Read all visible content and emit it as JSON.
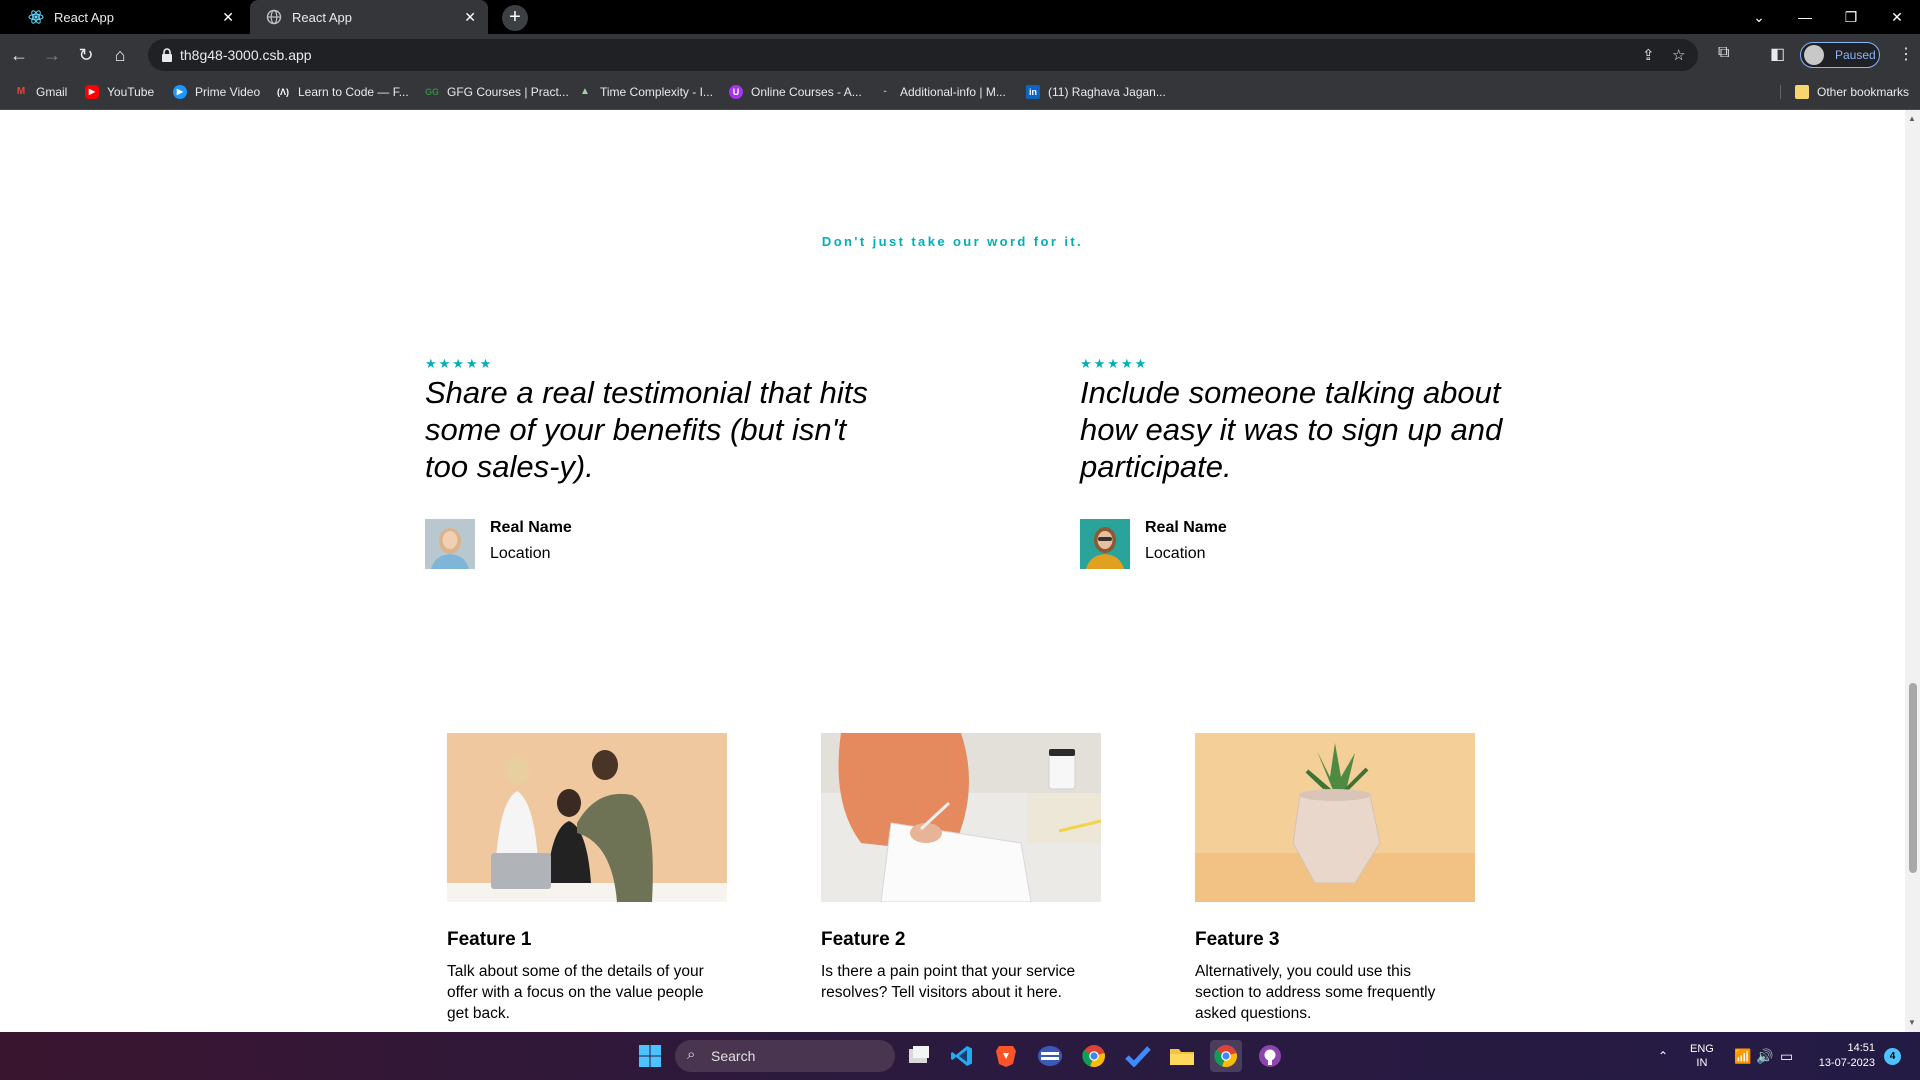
{
  "browser": {
    "tabs": [
      {
        "title": "React App",
        "active": false
      },
      {
        "title": "React App",
        "active": true
      }
    ],
    "url": "th8g48-3000.csb.app",
    "profile_status": "Paused",
    "bookmarks": [
      {
        "label": "Gmail",
        "icon": "gmail-icon"
      },
      {
        "label": "YouTube",
        "icon": "youtube-icon"
      },
      {
        "label": "Prime Video",
        "icon": "prime-video-icon"
      },
      {
        "label": "Learn to Code — F...",
        "icon": "freecodecamp-icon"
      },
      {
        "label": "GFG Courses | Pract...",
        "icon": "gfg-icon"
      },
      {
        "label": "Time Complexity - I...",
        "icon": "mountain-icon"
      },
      {
        "label": "Online Courses - A...",
        "icon": "udemy-icon"
      },
      {
        "label": "Additional-info | M...",
        "icon": "dash-icon"
      },
      {
        "label": "(11) Raghava Jagan...",
        "icon": "linkedin-icon"
      }
    ],
    "other_bookmarks": "Other bookmarks"
  },
  "page": {
    "tagline": "Don't just take our word for it.",
    "testimonials": [
      {
        "stars": "★★★★★",
        "quote": "Share a real testimonial that hits some of your benefits (but isn't too sales-y).",
        "name": "Real Name",
        "location": "Location"
      },
      {
        "stars": "★★★★★",
        "quote": "Include someone talking about how easy it was to sign up and participate.",
        "name": "Real Name",
        "location": "Location"
      }
    ],
    "features": [
      {
        "title": "Feature 1",
        "text": "Talk about some of the details of your offer with a focus on the value people get back."
      },
      {
        "title": "Feature 2",
        "text": "Is there a pain point that your service resolves? Tell visitors about it here."
      },
      {
        "title": "Feature 3",
        "text": "Alternatively, you could use this section to address some frequently asked questions."
      }
    ],
    "accent_color": "#00afb9"
  },
  "taskbar": {
    "search_label": "Search",
    "language": "ENG",
    "region": "IN",
    "time": "14:51",
    "date": "13-07-2023",
    "notification_count": "4"
  }
}
